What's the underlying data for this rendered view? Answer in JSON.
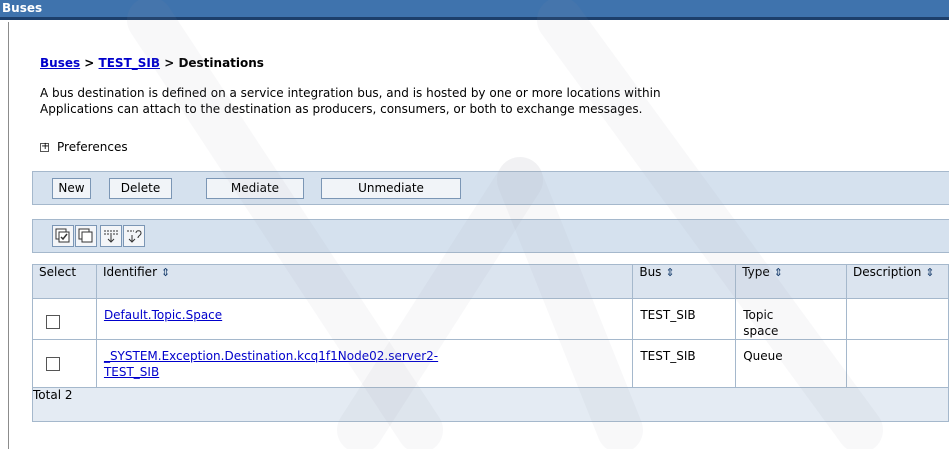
{
  "window": {
    "title": "Buses"
  },
  "breadcrumb": {
    "link1": "Buses",
    "sep1": " > ",
    "link2": "TEST_SIB",
    "sep2": " > ",
    "current": "Destinations"
  },
  "description": {
    "line1": "A bus destination is defined on a service integration bus, and is hosted by one or more locations within",
    "line2": "Applications can attach to the destination as producers, consumers, or both to exchange messages."
  },
  "preferences": {
    "label": "Preferences"
  },
  "toolbar": {
    "new": "New",
    "delete": "Delete",
    "mediate": "Mediate",
    "unmediate": "Unmediate"
  },
  "icon_toolbar": [
    "select-all-icon",
    "deselect-all-icon",
    "show-filter-icon",
    "clear-filter-icon"
  ],
  "table": {
    "headers": {
      "select": "Select",
      "identifier": "Identifier",
      "bus": "Bus",
      "type": "Type",
      "description": "Description"
    },
    "sort_symbol": "⇕",
    "rows": [
      {
        "identifier": "Default.Topic.Space",
        "bus": "TEST_SIB",
        "type_line1": "Topic",
        "type_line2": "space",
        "description": ""
      },
      {
        "identifier_line1": "_SYSTEM.Exception.Destination.kcq1f1Node02.server2-",
        "identifier_line2": "TEST_SIB",
        "bus": "TEST_SIB",
        "type": "Queue",
        "description": ""
      }
    ],
    "total": "Total 2"
  }
}
